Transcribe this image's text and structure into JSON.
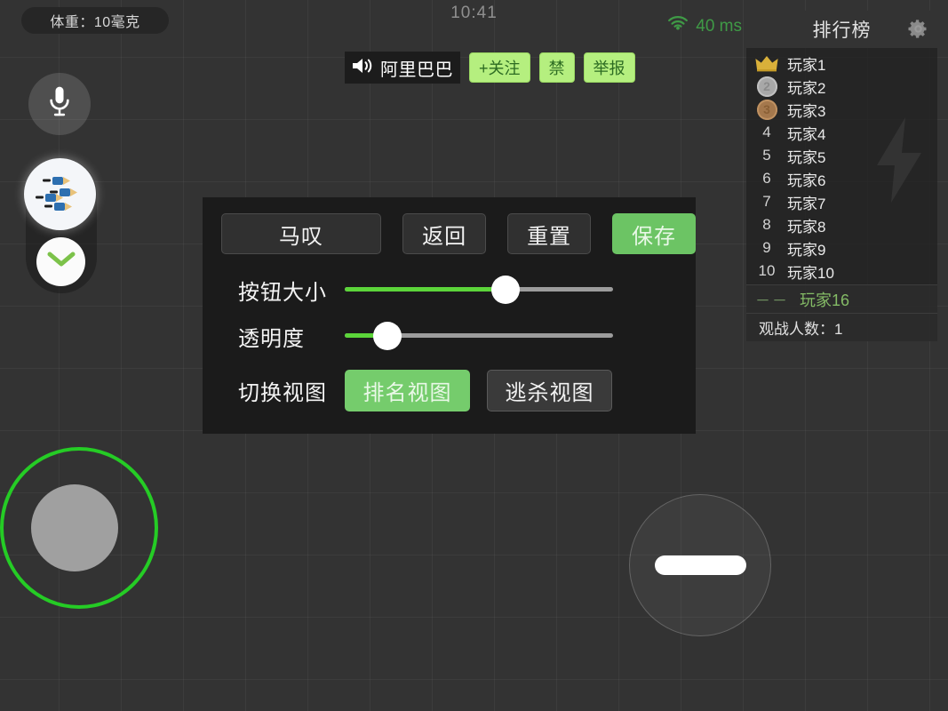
{
  "hud": {
    "weight_label": "体重：10毫克",
    "clock": "10:41",
    "ping_value": "40 ms",
    "ping_icon": "wifi-icon",
    "weight_icon": "weight-badge"
  },
  "broadcast": {
    "speaker_icon": "speaker-icon",
    "speaker_name": "阿里巴巴",
    "follow_label": "+关注",
    "ban_label": "禁",
    "report_label": "举报",
    "accent_color": "#b5ef7f"
  },
  "leaderboard": {
    "title": "排行榜",
    "gear_icon": "gear-icon",
    "watermark_icon": "lightning-bolt-icon",
    "rows": [
      {
        "rank": "1",
        "badge": "crown",
        "name": "玩家1"
      },
      {
        "rank": "2",
        "badge": "silver",
        "name": "玩家2"
      },
      {
        "rank": "3",
        "badge": "bronze",
        "name": "玩家3"
      },
      {
        "rank": "4",
        "badge": "none",
        "name": "玩家4"
      },
      {
        "rank": "5",
        "badge": "none",
        "name": "玩家5"
      },
      {
        "rank": "6",
        "badge": "none",
        "name": "玩家6"
      },
      {
        "rank": "7",
        "badge": "none",
        "name": "玩家7"
      },
      {
        "rank": "8",
        "badge": "none",
        "name": "玩家8"
      },
      {
        "rank": "9",
        "badge": "none",
        "name": "玩家9"
      },
      {
        "rank": "10",
        "badge": "none",
        "name": "玩家10"
      }
    ],
    "self_rank": "－－",
    "self_name": "玩家16",
    "self_color": "#84bb66",
    "spectators_label": "观战人数：1"
  },
  "left_controls": {
    "mic_icon": "microphone-icon",
    "spray_icon": "spray-darts-icon",
    "collapse_icon": "chevron-down-icon"
  },
  "settings_dialog": {
    "title_button": "马叹",
    "back_button": "返回",
    "reset_button": "重置",
    "save_button": "保存",
    "save_color": "#6cc464",
    "button_size": {
      "label": "按钮大小",
      "percent": 60
    },
    "opacity": {
      "label": "透明度",
      "percent": 16
    },
    "switch_view": {
      "label": "切换视图",
      "options": [
        {
          "label": "排名视图",
          "active": true
        },
        {
          "label": "逃杀视图",
          "active": false
        }
      ]
    }
  },
  "game_controls": {
    "joystick_icon": "virtual-joystick",
    "joystick_ring_color": "#25cc25",
    "action_icon": "dash-action-icon"
  }
}
